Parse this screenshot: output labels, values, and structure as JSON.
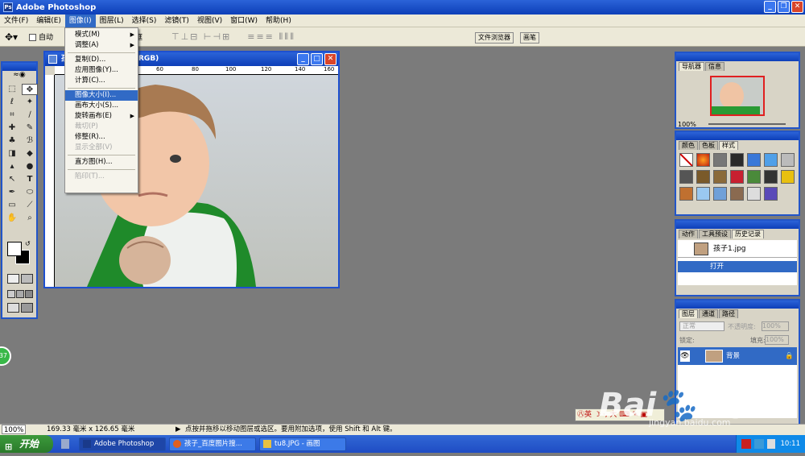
{
  "window": {
    "title": "Adobe Photoshop"
  },
  "menubar": [
    "文件(F)",
    "编辑(E)",
    "图像(I)",
    "图层(L)",
    "选择(S)",
    "滤镜(T)",
    "视图(V)",
    "窗口(W)",
    "帮助(H)"
  ],
  "options": {
    "auto_label": "自动",
    "bounds_label": "定界框",
    "file_browser": "文件浏览器",
    "brushes": "画笔"
  },
  "image_menu": [
    {
      "label": "模式(M)",
      "sub": true
    },
    {
      "label": "调整(A)",
      "sub": true
    },
    {
      "sep": true
    },
    {
      "label": "复制(D)..."
    },
    {
      "label": "应用图像(Y)..."
    },
    {
      "label": "计算(C)..."
    },
    {
      "sep": true
    },
    {
      "label": "图像大小(I)...",
      "highlight": true
    },
    {
      "label": "画布大小(S)..."
    },
    {
      "label": "旋转画布(E)",
      "sub": true
    },
    {
      "label": "裁切(P)",
      "disabled": true
    },
    {
      "label": "修整(R)..."
    },
    {
      "label": "显示全部(V)",
      "disabled": true
    },
    {
      "sep": true
    },
    {
      "label": "直方图(H)..."
    },
    {
      "sep": true
    },
    {
      "label": "陷印(T)...",
      "disabled": true
    }
  ],
  "doc": {
    "title_left": "孩",
    "title_right": "RGB)",
    "ruler": [
      "60",
      "80",
      "100",
      "120",
      "140",
      "160"
    ]
  },
  "navigator": {
    "tabs": [
      "导航器",
      "信息"
    ],
    "zoom": "100%"
  },
  "swatches": {
    "tabs": [
      "颜色",
      "色板",
      "样式"
    ]
  },
  "history": {
    "tabs": [
      "动作",
      "工具预设",
      "历史记录"
    ],
    "file": "孩子1.jpg",
    "step": "打开"
  },
  "layers": {
    "tabs": [
      "图层",
      "通道",
      "路径"
    ],
    "mode": "正常",
    "opacity_label": "不透明度:",
    "opacity": "100%",
    "lock_label": "锁定:",
    "fill_label": "填充:",
    "fill": "100%",
    "layer_name": "背景"
  },
  "status": {
    "zoom": "100%",
    "size": "169.33 毫米 x 126.65 毫米",
    "hint": "点按并拖移以移动图层或选区。要用附加选项，使用 Shift 和 Alt 键。"
  },
  "ime": {
    "text": "英",
    "text2": "大"
  },
  "taskbar": {
    "start": "开始",
    "tasks": [
      "Adobe Photoshop",
      "孩子_百度图片搜...",
      "tu8.JPG - 画图"
    ],
    "clock": "10:11"
  },
  "watermark": {
    "brand": "Bai",
    "brand2": "经验",
    "url": "jingyan.baidu.com"
  },
  "badge": "37",
  "colors": {
    "xp_blue": "#2b63d8",
    "highlight": "#316ac5",
    "workspace": "#7b7b7b"
  }
}
